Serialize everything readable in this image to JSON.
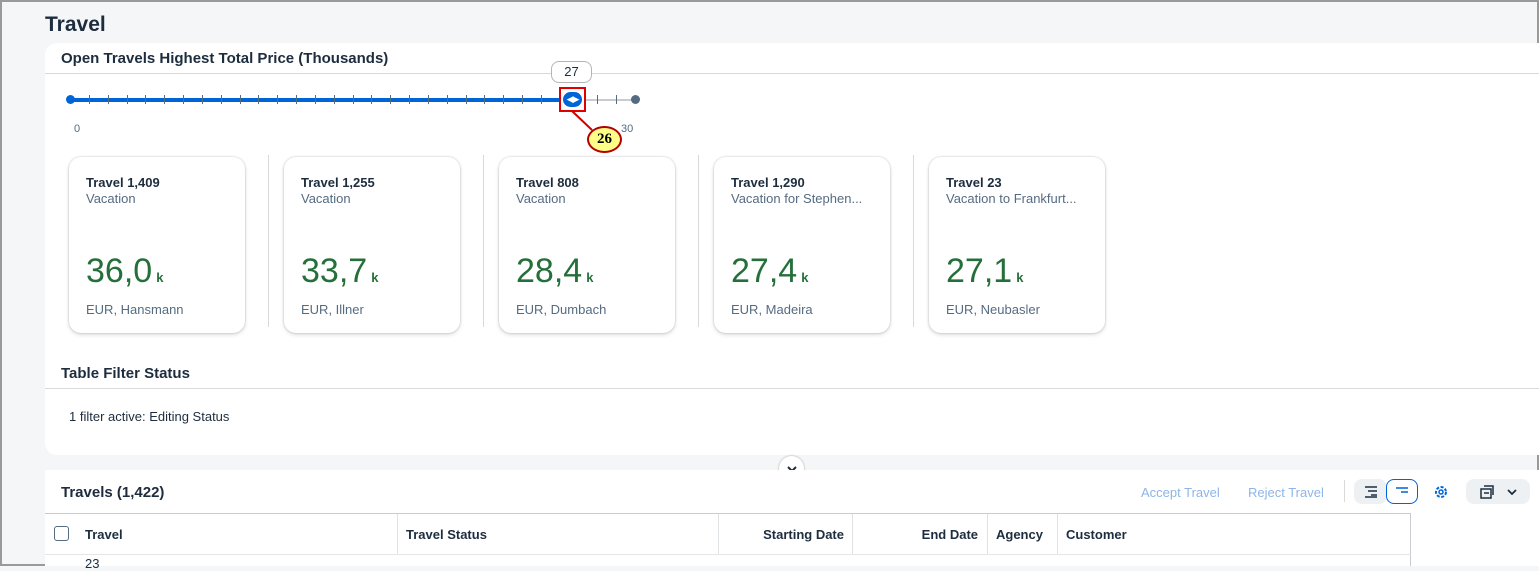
{
  "page": {
    "title": "Travel"
  },
  "chart_section": {
    "title": "Open Travels Highest Total Price (Thousands)",
    "slider": {
      "min_label": "0",
      "max_label": "30",
      "value": 27,
      "tooltip": "27"
    },
    "annotation": "26"
  },
  "cards": [
    {
      "title": "Travel 1,409",
      "subtitle": "Vacation",
      "value": "36,0",
      "scale": "k",
      "footer": "EUR, Hansmann"
    },
    {
      "title": "Travel 1,255",
      "subtitle": "Vacation",
      "value": "33,7",
      "scale": "k",
      "footer": "EUR, Illner"
    },
    {
      "title": "Travel 808",
      "subtitle": "Vacation",
      "value": "28,4",
      "scale": "k",
      "footer": "EUR, Dumbach"
    },
    {
      "title": "Travel 1,290",
      "subtitle": "Vacation for Stephen...",
      "value": "27,4",
      "scale": "k",
      "footer": "EUR, Madeira"
    },
    {
      "title": "Travel 23",
      "subtitle": "Vacation to Frankfurt...",
      "value": "27,1",
      "scale": "k",
      "footer": "EUR, Neubasler"
    }
  ],
  "filter_section": {
    "title": "Table Filter Status",
    "text": "1 filter active: Editing Status"
  },
  "table": {
    "title": "Travels (1,422)",
    "actions": {
      "accept": "Accept Travel",
      "reject": "Reject Travel"
    },
    "columns": [
      "Travel",
      "Travel Status",
      "Starting Date",
      "End Date",
      "Agency",
      "Customer"
    ],
    "first_row_partial": "23"
  },
  "colors": {
    "accent": "#0064d9",
    "positive": "#256f3a",
    "annotation_border": "#e00000"
  },
  "icons": [
    "chevron-down-icon",
    "settings-gear-icon",
    "export-icon",
    "table-hierarchy-icon"
  ]
}
